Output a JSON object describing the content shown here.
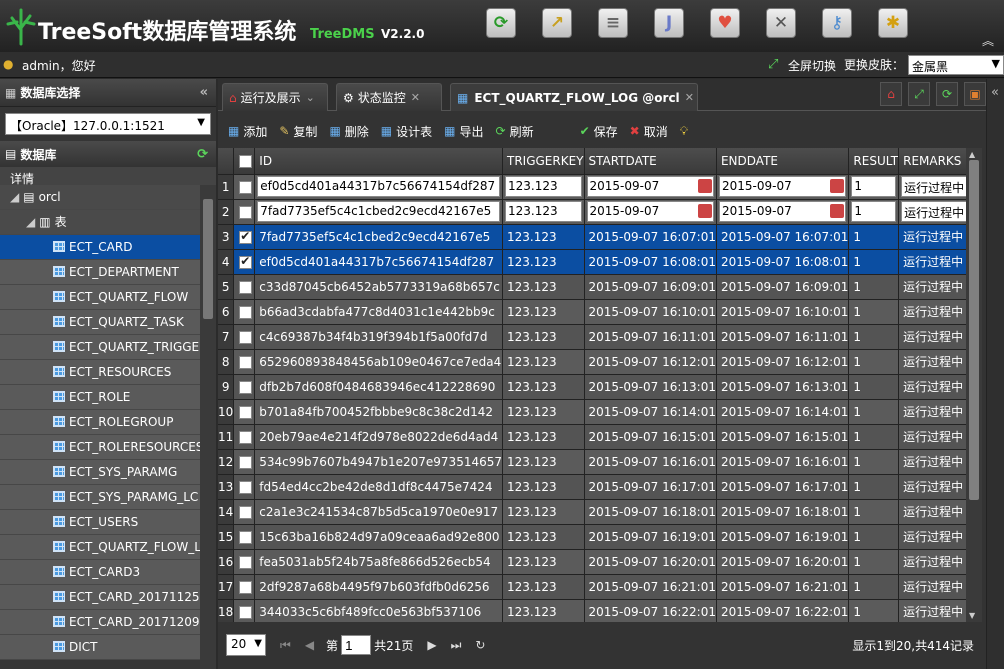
{
  "header": {
    "title": "TreeSoft数据库管理系统",
    "subtitle": "TreeDMS",
    "version": "V2.2.0",
    "icons": [
      "refresh-icon",
      "chart-icon",
      "database-icon",
      "java-icon",
      "heart-icon",
      "tools-icon",
      "key-icon",
      "person-icon"
    ]
  },
  "userbar": {
    "greeting": "admin，您好",
    "fullscreen": "全屏切换",
    "skin_label": "更换皮肤：",
    "skin_value": "金属黑"
  },
  "sidebar": {
    "db_select_title": "数据库选择",
    "db_select_value": "【Oracle】127.0.0.1:1521",
    "db_title": "数据库",
    "detail": "详情",
    "tree": [
      {
        "label": "orcl",
        "level": 0,
        "icon": "db"
      },
      {
        "label": "表",
        "level": 1,
        "icon": "tables"
      },
      {
        "label": "ECT_CARD",
        "level": 2,
        "selected": true
      },
      {
        "label": "ECT_DEPARTMENT",
        "level": 2
      },
      {
        "label": "ECT_QUARTZ_FLOW",
        "level": 2
      },
      {
        "label": "ECT_QUARTZ_TASK",
        "level": 2
      },
      {
        "label": "ECT_QUARTZ_TRIGGE",
        "level": 2
      },
      {
        "label": "ECT_RESOURCES",
        "level": 2
      },
      {
        "label": "ECT_ROLE",
        "level": 2
      },
      {
        "label": "ECT_ROLEGROUP",
        "level": 2
      },
      {
        "label": "ECT_ROLERESOURCES",
        "level": 2
      },
      {
        "label": "ECT_SYS_PARAMG",
        "level": 2
      },
      {
        "label": "ECT_SYS_PARAMG_LC",
        "level": 2
      },
      {
        "label": "ECT_USERS",
        "level": 2
      },
      {
        "label": "ECT_QUARTZ_FLOW_L",
        "level": 2
      },
      {
        "label": "ECT_CARD3",
        "level": 2
      },
      {
        "label": "ECT_CARD_20171125",
        "level": 2
      },
      {
        "label": "ECT_CARD_20171209",
        "level": 2
      },
      {
        "label": "DICT",
        "level": 2
      }
    ]
  },
  "tabs": [
    {
      "label": "运行及展示",
      "icon": "home-icon"
    },
    {
      "label": "状态监控",
      "icon": "monitor-icon"
    },
    {
      "label": "ECT_QUARTZ_FLOW_LOG @orcl",
      "icon": "table-icon",
      "active": true
    }
  ],
  "toolbar": {
    "add": "添加",
    "copy": "复制",
    "delete": "删除",
    "design": "设计表",
    "export": "导出",
    "refresh": "刷新",
    "save": "保存",
    "cancel": "取消"
  },
  "grid": {
    "columns": [
      "ID",
      "TRIGGERKEY",
      "STARTDATE",
      "ENDDATE",
      "RESULT",
      "REMARKS"
    ],
    "rows": [
      {
        "n": "1",
        "state": "edit",
        "checked": false,
        "id": "ef0d5cd401a44317b7c56674154df287",
        "key": "123.123",
        "start": "2015-09-07",
        "end": "2015-09-07",
        "result": "1",
        "remarks": "运行过程中"
      },
      {
        "n": "2",
        "state": "edit",
        "checked": false,
        "id": "7fad7735ef5c4c1cbed2c9ecd42167e5",
        "key": "123.123",
        "start": "2015-09-07",
        "end": "2015-09-07",
        "result": "1",
        "remarks": "运行过程中"
      },
      {
        "n": "3",
        "state": "sel",
        "checked": true,
        "id": "7fad7735ef5c4c1cbed2c9ecd42167e5",
        "key": "123.123",
        "start": "2015-09-07 16:07:01",
        "end": "2015-09-07 16:07:01",
        "result": "1",
        "remarks": "运行过程中"
      },
      {
        "n": "4",
        "state": "sel",
        "checked": true,
        "id": "ef0d5cd401a44317b7c56674154df287",
        "key": "123.123",
        "start": "2015-09-07 16:08:01",
        "end": "2015-09-07 16:08:01",
        "result": "1",
        "remarks": "运行过程中"
      },
      {
        "n": "5",
        "state": "alt",
        "checked": false,
        "id": "c33d87045cb6452ab5773319a68b657c",
        "key": "123.123",
        "start": "2015-09-07 16:09:01",
        "end": "2015-09-07 16:09:01",
        "result": "1",
        "remarks": "运行过程中"
      },
      {
        "n": "6",
        "state": "norm",
        "checked": false,
        "id": "b66ad3cdabfa477c8d4031c1e442bb9c",
        "key": "123.123",
        "start": "2015-09-07 16:10:01",
        "end": "2015-09-07 16:10:01",
        "result": "1",
        "remarks": "运行过程中"
      },
      {
        "n": "7",
        "state": "alt",
        "checked": false,
        "id": "c4c69387b34f4b319f394b1f5a00fd7d",
        "key": "123.123",
        "start": "2015-09-07 16:11:01",
        "end": "2015-09-07 16:11:01",
        "result": "1",
        "remarks": "运行过程中"
      },
      {
        "n": "8",
        "state": "norm",
        "checked": false,
        "id": "652960893848456ab109e0467ce7eda4",
        "key": "123.123",
        "start": "2015-09-07 16:12:01",
        "end": "2015-09-07 16:12:01",
        "result": "1",
        "remarks": "运行过程中"
      },
      {
        "n": "9",
        "state": "alt",
        "checked": false,
        "id": "dfb2b7d608f0484683946ec412228690",
        "key": "123.123",
        "start": "2015-09-07 16:13:01",
        "end": "2015-09-07 16:13:01",
        "result": "1",
        "remarks": "运行过程中"
      },
      {
        "n": "10",
        "state": "norm",
        "checked": false,
        "id": "b701a84fb700452fbbbe9c8c38c2d142",
        "key": "123.123",
        "start": "2015-09-07 16:14:01",
        "end": "2015-09-07 16:14:01",
        "result": "1",
        "remarks": "运行过程中"
      },
      {
        "n": "11",
        "state": "alt",
        "checked": false,
        "id": "20eb79ae4e214f2d978e8022de6d4ad4",
        "key": "123.123",
        "start": "2015-09-07 16:15:01",
        "end": "2015-09-07 16:15:01",
        "result": "1",
        "remarks": "运行过程中"
      },
      {
        "n": "12",
        "state": "norm",
        "checked": false,
        "id": "534c99b7607b4947b1e207e973514657",
        "key": "123.123",
        "start": "2015-09-07 16:16:01",
        "end": "2015-09-07 16:16:01",
        "result": "1",
        "remarks": "运行过程中"
      },
      {
        "n": "13",
        "state": "alt",
        "checked": false,
        "id": "fd54ed4cc2be42de8d1df8c4475e7424",
        "key": "123.123",
        "start": "2015-09-07 16:17:01",
        "end": "2015-09-07 16:17:01",
        "result": "1",
        "remarks": "运行过程中"
      },
      {
        "n": "14",
        "state": "norm",
        "checked": false,
        "id": "c2a1e3c241534c87b5d5ca1970e0e917",
        "key": "123.123",
        "start": "2015-09-07 16:18:01",
        "end": "2015-09-07 16:18:01",
        "result": "1",
        "remarks": "运行过程中"
      },
      {
        "n": "15",
        "state": "alt",
        "checked": false,
        "id": "15c63ba16b824d97a09ceaa6ad92e800",
        "key": "123.123",
        "start": "2015-09-07 16:19:01",
        "end": "2015-09-07 16:19:01",
        "result": "1",
        "remarks": "运行过程中"
      },
      {
        "n": "16",
        "state": "norm",
        "checked": false,
        "id": "fea5031ab5f24b75a8fe866d526ecb54",
        "key": "123.123",
        "start": "2015-09-07 16:20:01",
        "end": "2015-09-07 16:20:01",
        "result": "1",
        "remarks": "运行过程中"
      },
      {
        "n": "17",
        "state": "alt",
        "checked": false,
        "id": "2df9287a68b4495f97b603fdfb0d6256",
        "key": "123.123",
        "start": "2015-09-07 16:21:01",
        "end": "2015-09-07 16:21:01",
        "result": "1",
        "remarks": "运行过程中"
      },
      {
        "n": "18",
        "state": "norm",
        "checked": false,
        "id": "344033c5c6bf489fcc0e563bf537106",
        "key": "123.123",
        "start": "2015-09-07 16:22:01",
        "end": "2015-09-07 16:22:01",
        "result": "1",
        "remarks": "运行过程中"
      }
    ]
  },
  "pager": {
    "page_size": "20",
    "page_prefix": "第",
    "page_value": "1",
    "page_suffix": "共21页",
    "info": "显示1到20,共414记录"
  }
}
